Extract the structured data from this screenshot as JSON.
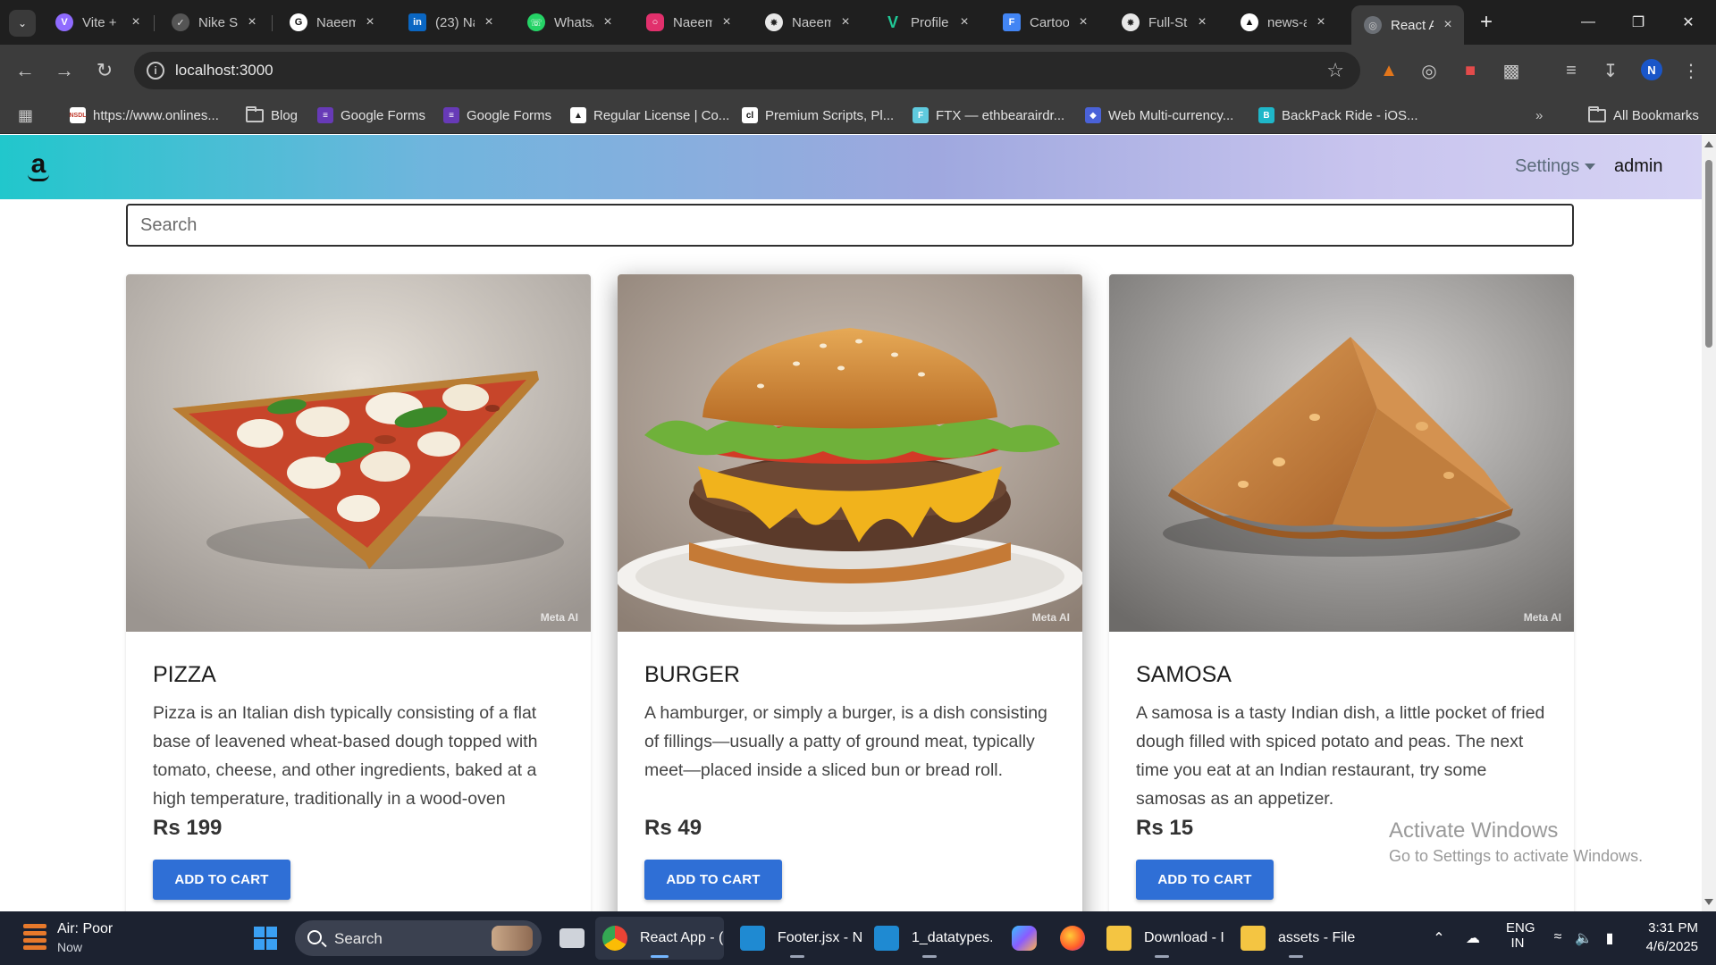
{
  "browser": {
    "tabs": [
      {
        "title": "Vite +",
        "icon": "vite-icon",
        "color": "#8f6bff"
      },
      {
        "title": "Nike Sl",
        "icon": "nike-icon",
        "color": "#d9d9d9"
      },
      {
        "title": "Naeem",
        "icon": "github-icon",
        "color": "#ffffff"
      },
      {
        "title": "(23) Na",
        "icon": "linkedin-icon",
        "color": "#0a66c2"
      },
      {
        "title": "WhatsA",
        "icon": "whatsapp-icon",
        "color": "#25d366"
      },
      {
        "title": "Naeem",
        "icon": "instagram-icon",
        "color": "#e1306c"
      },
      {
        "title": "Naeem",
        "icon": "openai-icon",
        "color": "#e8e8e8"
      },
      {
        "title": "Profile",
        "icon": "vercel-v-icon",
        "color": "#20c997"
      },
      {
        "title": "Cartoo",
        "icon": "forms-icon",
        "color": "#4285f4"
      },
      {
        "title": "Full-St",
        "icon": "openai-icon",
        "color": "#e8e8e8"
      },
      {
        "title": "news-a",
        "icon": "triangle-icon",
        "color": "#ffffff"
      },
      {
        "title": "React A",
        "icon": "globe-icon",
        "color": "#9aa0a6"
      }
    ],
    "url": "localhost:3000",
    "profile_initial": "N",
    "bookmarks": [
      {
        "label": "https://www.onlines...",
        "icon": "nsdl-icon"
      },
      {
        "label": "Blog",
        "icon": "folder-icon"
      },
      {
        "label": "Google Forms",
        "icon": "forms-icon"
      },
      {
        "label": "Google Forms",
        "icon": "forms-icon"
      },
      {
        "label": "Regular License | Co...",
        "icon": "envato-icon"
      },
      {
        "label": "Premium Scripts, Pl...",
        "icon": "codecanyon-icon"
      },
      {
        "label": "FTX — ethbearairdr...",
        "icon": "ftx-icon"
      },
      {
        "label": "Web Multi-currency...",
        "icon": "shield-icon"
      },
      {
        "label": "BackPack Ride - iOS...",
        "icon": "backpack-icon"
      }
    ],
    "all_bookmarks_label": "All Bookmarks"
  },
  "page": {
    "nav": {
      "settings_label": "Settings",
      "user_label": "admin"
    },
    "search_placeholder": "Search",
    "products": [
      {
        "name": "PIZZA",
        "description": "Pizza is an Italian dish typically consisting of a flat base of leavened wheat-based dough topped with tomato, cheese, and other ingredients, baked at a high temperature, traditionally in a wood-oven",
        "price": "Rs 199",
        "button": "ADD TO CART",
        "watermark": "Meta AI"
      },
      {
        "name": "BURGER",
        "description": "A hamburger, or simply a burger, is a dish consisting of fillings—usually a patty of ground meat, typically meet—placed inside a sliced bun or bread roll.",
        "price": "Rs 49",
        "button": "ADD TO CART",
        "watermark": "Meta AI"
      },
      {
        "name": "SAMOSA",
        "description": "A samosa is a tasty Indian dish, a little pocket of fried dough filled with spiced potato and peas. The next time you eat at an Indian restaurant, try some samosas as an appetizer.",
        "price": "Rs 15",
        "button": "ADD TO CART",
        "watermark": "Meta AI"
      }
    ],
    "overlay": {
      "line1": "Activate Windows",
      "line2": "Go to Settings to activate Windows."
    }
  },
  "taskbar": {
    "weather_title": "Air: Poor",
    "weather_sub": "Now",
    "search_label": "Search",
    "apps": [
      {
        "label": "React App - (",
        "icon": "chrome-icon"
      },
      {
        "label": "Footer.jsx - N",
        "icon": "vscode-icon"
      },
      {
        "label": "1_datatypes.j",
        "icon": "vscode-icon"
      },
      {
        "label": "",
        "icon": "copilot-icon"
      },
      {
        "label": "",
        "icon": "firefox-icon"
      },
      {
        "label": "Download - I",
        "icon": "file-explorer-icon"
      },
      {
        "label": "assets - File",
        "icon": "file-explorer-icon"
      }
    ],
    "lang_top": "ENG",
    "lang_bottom": "IN",
    "time": "3:31 PM",
    "date": "4/6/2025"
  }
}
